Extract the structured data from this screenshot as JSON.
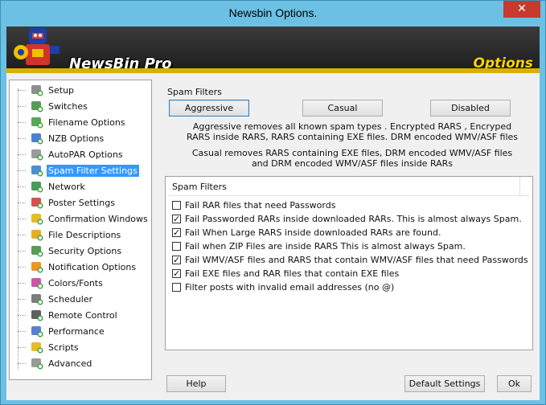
{
  "window": {
    "title": "Newsbin Options.",
    "close_label": "✕"
  },
  "banner": {
    "brand": "NewsBin Pro",
    "section": "Options"
  },
  "nav": {
    "items": [
      {
        "label": "Setup",
        "icon": "gear-icon"
      },
      {
        "label": "Switches",
        "icon": "switches-icon"
      },
      {
        "label": "Filename Options",
        "icon": "filename-icon"
      },
      {
        "label": "NZB Options",
        "icon": "nzb-icon"
      },
      {
        "label": "AutoPAR Options",
        "icon": "autopar-icon"
      },
      {
        "label": "Spam Filter Settings",
        "icon": "spam-filter-icon"
      },
      {
        "label": "Network",
        "icon": "network-icon"
      },
      {
        "label": "Poster Settings",
        "icon": "poster-icon"
      },
      {
        "label": "Confirmation Windows",
        "icon": "warning-icon"
      },
      {
        "label": "File Descriptions",
        "icon": "file-desc-icon"
      },
      {
        "label": "Security Options",
        "icon": "security-icon"
      },
      {
        "label": "Notification Options",
        "icon": "rss-icon"
      },
      {
        "label": "Colors/Fonts",
        "icon": "colors-icon"
      },
      {
        "label": "Scheduler",
        "icon": "scheduler-icon"
      },
      {
        "label": "Remote Control",
        "icon": "remote-icon"
      },
      {
        "label": "Performance",
        "icon": "performance-icon"
      },
      {
        "label": "Scripts",
        "icon": "lightning-icon"
      },
      {
        "label": "Advanced",
        "icon": "advanced-gear-icon"
      }
    ],
    "selected_index": 5
  },
  "spam": {
    "group_title": "Spam Filters",
    "aggressive_label": "Aggressive",
    "casual_label": "Casual",
    "disabled_label": "Disabled",
    "aggressive_desc": "Aggressive removes all known spam types . Encrypted RARS , Encryped RARS inside RARS, RARS containing EXE files. DRM encoded WMV/ASF files",
    "casual_desc": "Casual removes RARS containing EXE files, DRM encoded WMV/ASF files and DRM encoded WMV/ASF files inside RARs",
    "list_header": "Spam Filters",
    "filters": [
      {
        "label": "Fail RAR files that need Passwords",
        "checked": false
      },
      {
        "label": "Fail Passworded RARs inside downloaded RARs. This is almost always Spam.",
        "checked": true
      },
      {
        "label": "Fail When Large RARS inside downloaded RARs are found.",
        "checked": true
      },
      {
        "label": "Fail when ZIP Files are inside RARS This is almost always Spam.",
        "checked": false
      },
      {
        "label": "Fail WMV/ASF files and RARS that contain WMV/ASF files that need Passwords",
        "checked": true
      },
      {
        "label": "Fail EXE files and RAR files that contain EXE files",
        "checked": true
      },
      {
        "label": "Filter posts with invalid email addresses (no @)",
        "checked": false
      }
    ]
  },
  "footer": {
    "help_label": "Help",
    "default_label": "Default Settings",
    "ok_label": "Ok"
  }
}
